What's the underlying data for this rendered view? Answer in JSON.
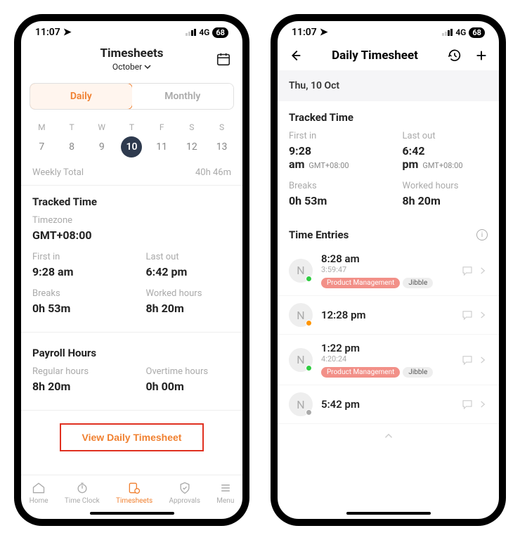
{
  "status": {
    "time": "11:07",
    "network": "4G",
    "battery": "68"
  },
  "screen1": {
    "title": "Timesheets",
    "month": "October",
    "tabs": {
      "daily": "Daily",
      "monthly": "Monthly"
    },
    "weekdays": [
      {
        "letter": "M",
        "num": "7"
      },
      {
        "letter": "T",
        "num": "8"
      },
      {
        "letter": "W",
        "num": "9"
      },
      {
        "letter": "T",
        "num": "10",
        "active": true
      },
      {
        "letter": "F",
        "num": "11"
      },
      {
        "letter": "S",
        "num": "12"
      },
      {
        "letter": "S",
        "num": "13"
      }
    ],
    "weekly_total_label": "Weekly Total",
    "weekly_total_value": "40h 46m",
    "tracked_title": "Tracked Time",
    "timezone_label": "Timezone",
    "timezone_value": "GMT+08:00",
    "first_in_label": "First in",
    "first_in_value": "9:28 am",
    "last_out_label": "Last out",
    "last_out_value": "6:42 pm",
    "breaks_label": "Breaks",
    "breaks_value": "0h 53m",
    "worked_label": "Worked hours",
    "worked_value": "8h 20m",
    "payroll_title": "Payroll Hours",
    "regular_label": "Regular hours",
    "regular_value": "8h 20m",
    "overtime_label": "Overtime hours",
    "overtime_value": "0h 00m",
    "view_btn": "View Daily Timesheet",
    "tabs_bottom": [
      "Home",
      "Time Clock",
      "Timesheets",
      "Approvals",
      "Menu"
    ]
  },
  "screen2": {
    "title": "Daily Timesheet",
    "date": "Thu, 10 Oct",
    "tracked_title": "Tracked Time",
    "first_in_label": "First in",
    "first_in_value": "9:28 am",
    "last_out_label": "Last out",
    "last_out_value": "6:42 pm",
    "tz": "GMT+08:00",
    "breaks_label": "Breaks",
    "breaks_value": "0h 53m",
    "worked_label": "Worked hours",
    "worked_value": "8h 20m",
    "entries_title": "Time Entries",
    "entries": [
      {
        "letter": "N",
        "dot": "green",
        "time": "8:28 am",
        "duration": "3:59:47",
        "tags": [
          "Product Management",
          "Jibble"
        ]
      },
      {
        "letter": "N",
        "dot": "orange",
        "time": "12:28 pm",
        "duration": "",
        "tags": []
      },
      {
        "letter": "N",
        "dot": "green",
        "time": "1:22 pm",
        "duration": "4:20:24",
        "tags": [
          "Product Management",
          "Jibble"
        ]
      },
      {
        "letter": "N",
        "dot": "gray",
        "time": "5:42 pm",
        "duration": "",
        "tags": []
      }
    ]
  }
}
